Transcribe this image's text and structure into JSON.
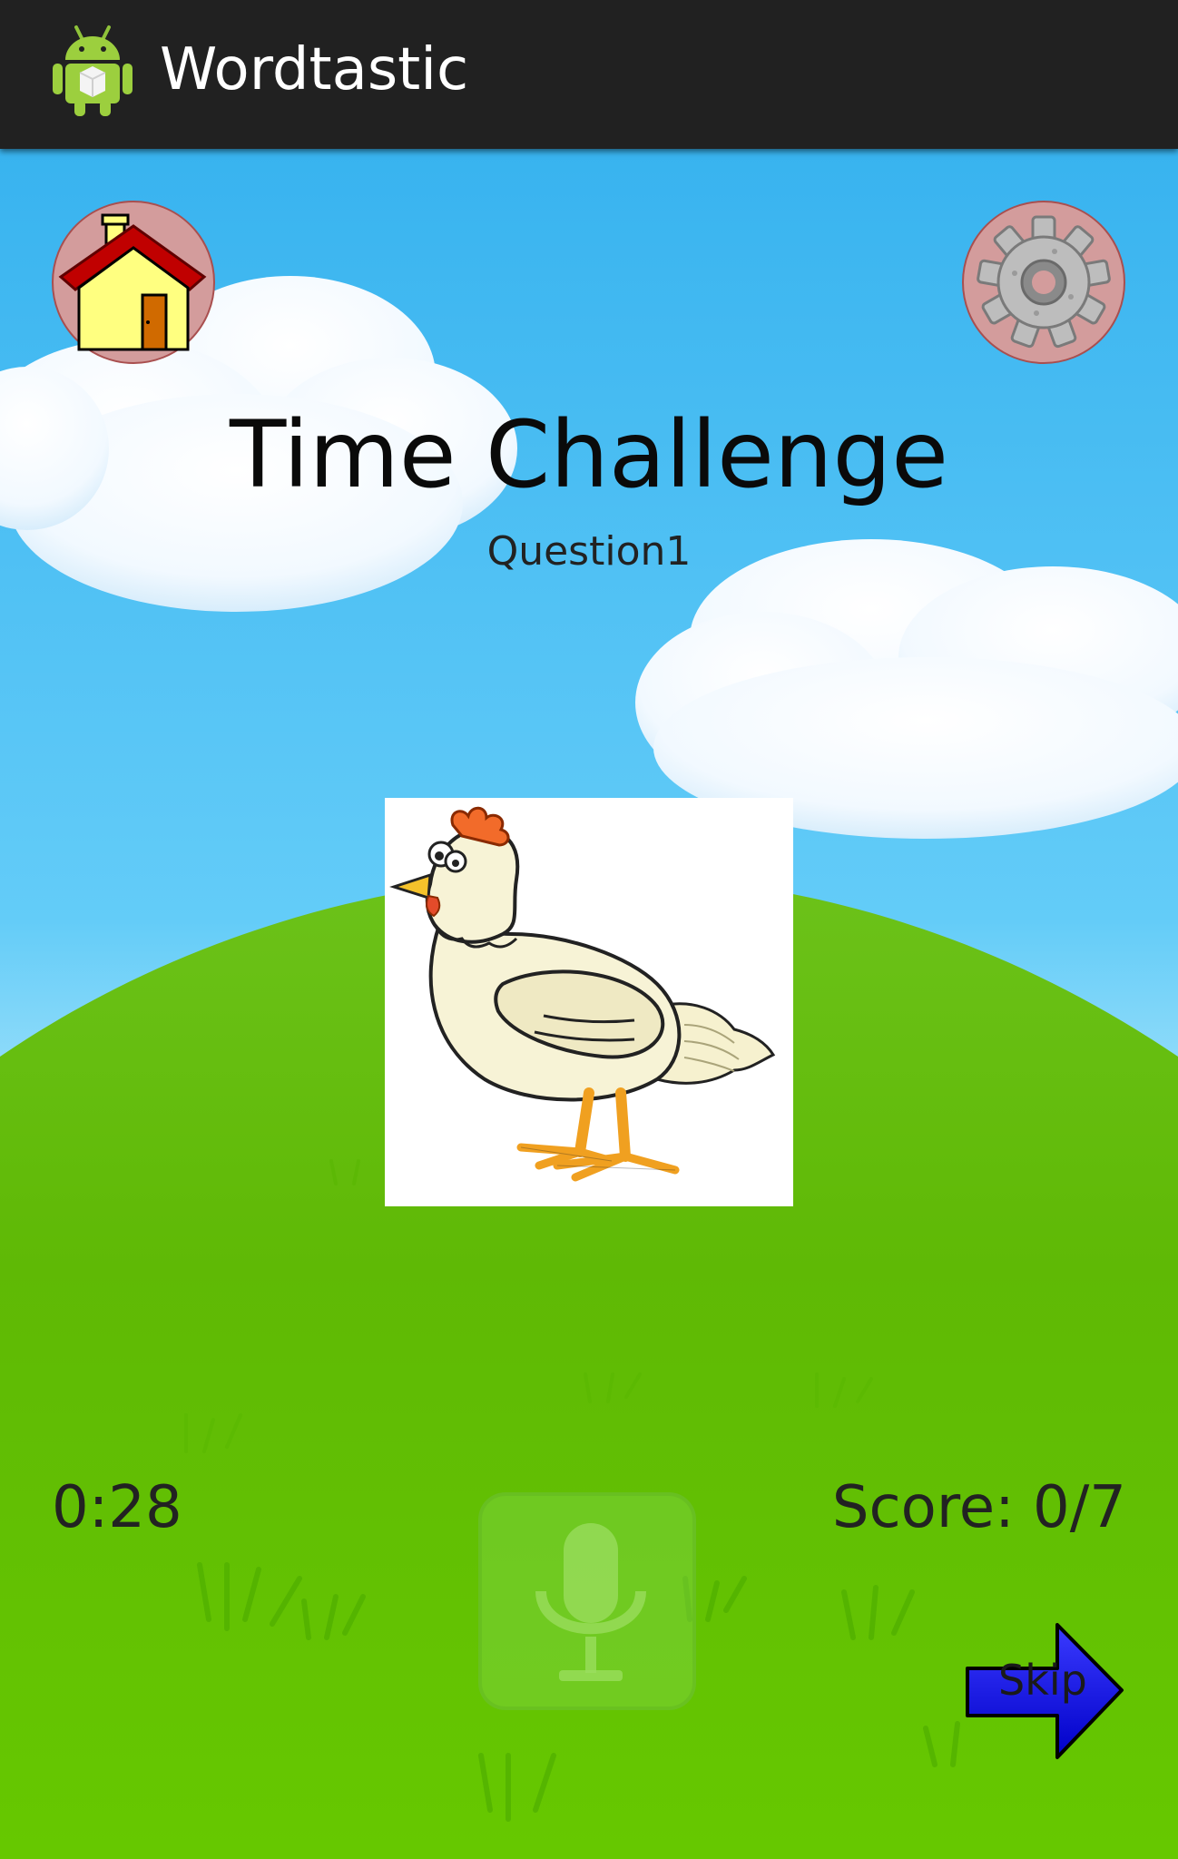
{
  "app": {
    "title": "Wordtastic",
    "icon": "android-icon"
  },
  "toolbar": {
    "home_icon": "home-icon",
    "settings_icon": "gear-icon"
  },
  "challenge": {
    "title": "Time Challenge",
    "question": "Question1",
    "picture": "chicken"
  },
  "status": {
    "timer": "0:28",
    "score": "Score: 0/7"
  },
  "controls": {
    "mic_icon": "microphone-icon",
    "skip_label": "Skip"
  },
  "colors": {
    "actionbar": "#212121",
    "sky": "#38b3ef",
    "grass": "#5cbd00",
    "skip_arrow": "#1a1aff",
    "button_ring": "#d39c9c"
  }
}
